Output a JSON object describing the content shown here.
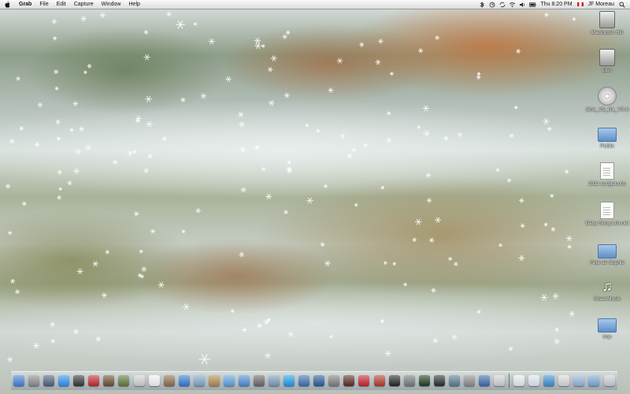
{
  "menubar": {
    "app_name": "Grab",
    "menus": [
      "File",
      "Edit",
      "Capture",
      "Window",
      "Help"
    ],
    "clock": "Thu 8:20 PM",
    "user": "JF Moreau",
    "status_icons": [
      "bluetooth-icon",
      "timemachine-icon",
      "sync-icon",
      "wifi-icon",
      "volume-icon",
      "battery-icon"
    ]
  },
  "desktop_icons": [
    {
      "label": "Macintosh HD",
      "icon": "hard-drive-icon"
    },
    {
      "label": "Lion",
      "icon": "hard-drive-icon"
    },
    {
      "label": "SG1_V5_R1_YR 8",
      "icon": "disc-icon"
    },
    {
      "label": "Public",
      "icon": "shared-folder-icon"
    },
    {
      "label": "2011 budget.ods",
      "icon": "spreadsheet-document-icon"
    },
    {
      "label": "Baby Song List.odt",
      "icon": "text-document-icon"
    },
    {
      "label": "Fete de Sophie",
      "icon": "folder-icon"
    },
    {
      "label": "ShareMusic",
      "icon": "music-icon"
    },
    {
      "label": "tmp",
      "icon": "folder-icon"
    }
  ],
  "dock": {
    "apps": [
      {
        "name": "finder-icon",
        "color": "#3d7fd6"
      },
      {
        "name": "launchpad-icon",
        "color": "#8a8a8a"
      },
      {
        "name": "mission-control-icon",
        "color": "#4a5f7a"
      },
      {
        "name": "app-store-icon",
        "color": "#2a8ff0"
      },
      {
        "name": "dashboard-icon",
        "color": "#333"
      },
      {
        "name": "photo-booth-icon",
        "color": "#c0262b"
      },
      {
        "name": "image-capture-icon",
        "color": "#6b4d2e"
      },
      {
        "name": "dictionary-icon",
        "color": "#5c7a3a"
      },
      {
        "name": "preview-icon",
        "color": "#cfcfcf"
      },
      {
        "name": "ical-icon",
        "color": "#f2f2f2"
      },
      {
        "name": "address-book-icon",
        "color": "#8a6b4a"
      },
      {
        "name": "safari-icon",
        "color": "#2f78d4"
      },
      {
        "name": "mail-icon",
        "color": "#7ea3c8"
      },
      {
        "name": "books-icon",
        "color": "#b08a4a"
      },
      {
        "name": "ichat-icon",
        "color": "#5aa0e0"
      },
      {
        "name": "itunes-icon",
        "color": "#4a8ad4"
      },
      {
        "name": "facetime-icon",
        "color": "#666"
      },
      {
        "name": "iphoto-icon",
        "color": "#7a9ab8"
      },
      {
        "name": "skype-icon",
        "color": "#1a9be6"
      },
      {
        "name": "network-icon",
        "color": "#3b6fb0"
      },
      {
        "name": "quicktime-icon",
        "color": "#2a5a9a"
      },
      {
        "name": "xcode-icon",
        "color": "#7c7c7c"
      },
      {
        "name": "flashback-icon",
        "color": "#5a2a20"
      },
      {
        "name": "acrobat-icon",
        "color": "#c8202a"
      },
      {
        "name": "tool-icon",
        "color": "#b03a2a"
      },
      {
        "name": "terminal-icon",
        "color": "#222"
      },
      {
        "name": "automator-icon",
        "color": "#777"
      },
      {
        "name": "activity-monitor-icon",
        "color": "#1d3a1d"
      },
      {
        "name": "console-icon",
        "color": "#2a2a2a"
      },
      {
        "name": "time-machine-icon",
        "color": "#5a7a8a"
      },
      {
        "name": "system-preferences-icon",
        "color": "#8a8a8a"
      },
      {
        "name": "utility-icon",
        "color": "#3a6ab0"
      },
      {
        "name": "grab-icon",
        "color": "#cfcfcf"
      }
    ],
    "stacks": [
      {
        "name": "screenshot-stack-icon",
        "color": "#eaeaea"
      },
      {
        "name": "music-stack-icon",
        "color": "#dfe6ee"
      },
      {
        "name": "app-stack-icon",
        "color": "#3a8fd0"
      },
      {
        "name": "documents-stack-icon",
        "color": "#d8d8d8"
      },
      {
        "name": "downloads-stack-icon",
        "color": "#8fb3da"
      },
      {
        "name": "folder-stack-icon",
        "color": "#7aa6d6"
      },
      {
        "name": "trash-icon",
        "color": "#c9ced4"
      }
    ]
  },
  "colors": {
    "menubar_bg": "#e6e6e6",
    "snow": "#ffffff",
    "accent_foliage": "#c8702f"
  }
}
